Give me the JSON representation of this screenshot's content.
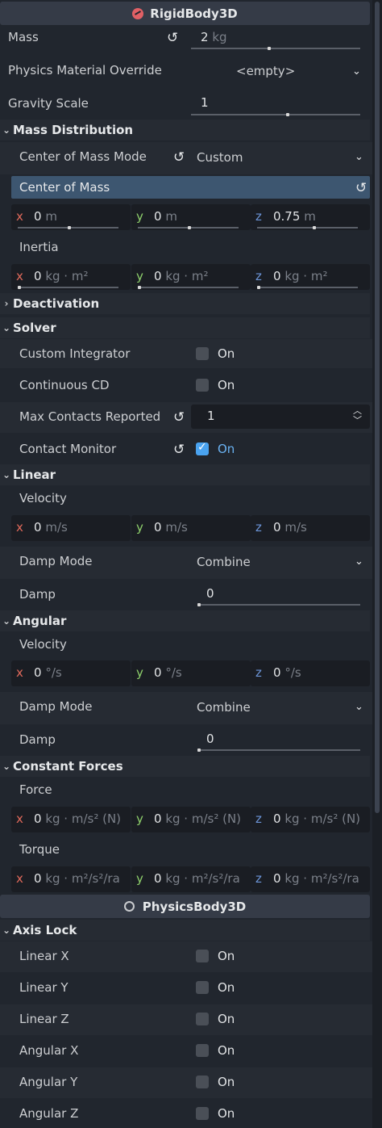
{
  "rigidbody_header": "RigidBody3D",
  "mass": {
    "label": "Mass",
    "value": "2",
    "unit": "kg",
    "slider_fraction": 0.45
  },
  "material": {
    "label": "Physics Material Override",
    "value": "<empty>"
  },
  "gravity": {
    "label": "Gravity Scale",
    "value": "1",
    "slider_fraction": 0.56
  },
  "mass_distribution": {
    "title": "Mass Distribution",
    "com_mode_label": "Center of Mass Mode",
    "com_mode_value": "Custom",
    "com_label": "Center of Mass",
    "com": {
      "x": {
        "axis": "x",
        "value": "0",
        "unit": "m"
      },
      "y": {
        "axis": "y",
        "value": "0",
        "unit": "m"
      },
      "z": {
        "axis": "z",
        "value": "0.75",
        "unit": "m"
      }
    },
    "inertia_label": "Inertia",
    "inertia": {
      "x": {
        "axis": "x",
        "value": "0",
        "unit": "kg · m²"
      },
      "y": {
        "axis": "y",
        "value": "0",
        "unit": "kg · m²"
      },
      "z": {
        "axis": "z",
        "value": "0",
        "unit": "kg · m²"
      }
    }
  },
  "deactivation": {
    "title": "Deactivation"
  },
  "solver": {
    "title": "Solver",
    "custom_integrator": {
      "label": "Custom Integrator",
      "on_label": "On",
      "checked": false
    },
    "continuous_cd": {
      "label": "Continuous CD",
      "on_label": "On",
      "checked": false
    },
    "max_contacts": {
      "label": "Max Contacts Reported",
      "value": "1"
    },
    "contact_monitor": {
      "label": "Contact Monitor",
      "on_label": "On",
      "checked": true
    }
  },
  "linear": {
    "title": "Linear",
    "velocity_label": "Velocity",
    "velocity": {
      "x": {
        "axis": "x",
        "value": "0",
        "unit": "m/s"
      },
      "y": {
        "axis": "y",
        "value": "0",
        "unit": "m/s"
      },
      "z": {
        "axis": "z",
        "value": "0",
        "unit": "m/s"
      }
    },
    "damp_mode_label": "Damp Mode",
    "damp_mode_value": "Combine",
    "damp_label": "Damp",
    "damp_value": "0"
  },
  "angular": {
    "title": "Angular",
    "velocity_label": "Velocity",
    "velocity": {
      "x": {
        "axis": "x",
        "value": "0",
        "unit": "°/s"
      },
      "y": {
        "axis": "y",
        "value": "0",
        "unit": "°/s"
      },
      "z": {
        "axis": "z",
        "value": "0",
        "unit": "°/s"
      }
    },
    "damp_mode_label": "Damp Mode",
    "damp_mode_value": "Combine",
    "damp_label": "Damp",
    "damp_value": "0"
  },
  "constant_forces": {
    "title": "Constant Forces",
    "force_label": "Force",
    "force": {
      "x": {
        "axis": "x",
        "value": "0",
        "unit": "kg · m/s² (N)"
      },
      "y": {
        "axis": "y",
        "value": "0",
        "unit": "kg · m/s² (N)"
      },
      "z": {
        "axis": "z",
        "value": "0",
        "unit": "kg · m/s² (N)"
      }
    },
    "torque_label": "Torque",
    "torque": {
      "x": {
        "axis": "x",
        "value": "0",
        "unit": "kg · m²/s²/ra"
      },
      "y": {
        "axis": "y",
        "value": "0",
        "unit": "kg · m²/s²/ra"
      },
      "z": {
        "axis": "z",
        "value": "0",
        "unit": "kg · m²/s²/ra"
      }
    }
  },
  "physicsbody_header": "PhysicsBody3D",
  "axis_lock": {
    "title": "Axis Lock",
    "items": [
      {
        "label": "Linear X",
        "on_label": "On",
        "checked": false
      },
      {
        "label": "Linear Y",
        "on_label": "On",
        "checked": false
      },
      {
        "label": "Linear Z",
        "on_label": "On",
        "checked": false
      },
      {
        "label": "Angular X",
        "on_label": "On",
        "checked": false
      },
      {
        "label": "Angular Y",
        "on_label": "On",
        "checked": false
      },
      {
        "label": "Angular Z",
        "on_label": "On",
        "checked": false
      }
    ]
  },
  "colors": {
    "accent": "#4aa3f0",
    "highlight": "#3d5670",
    "axis_x": "#e0695b",
    "axis_y": "#8fd16c",
    "axis_z": "#6c95d8"
  }
}
